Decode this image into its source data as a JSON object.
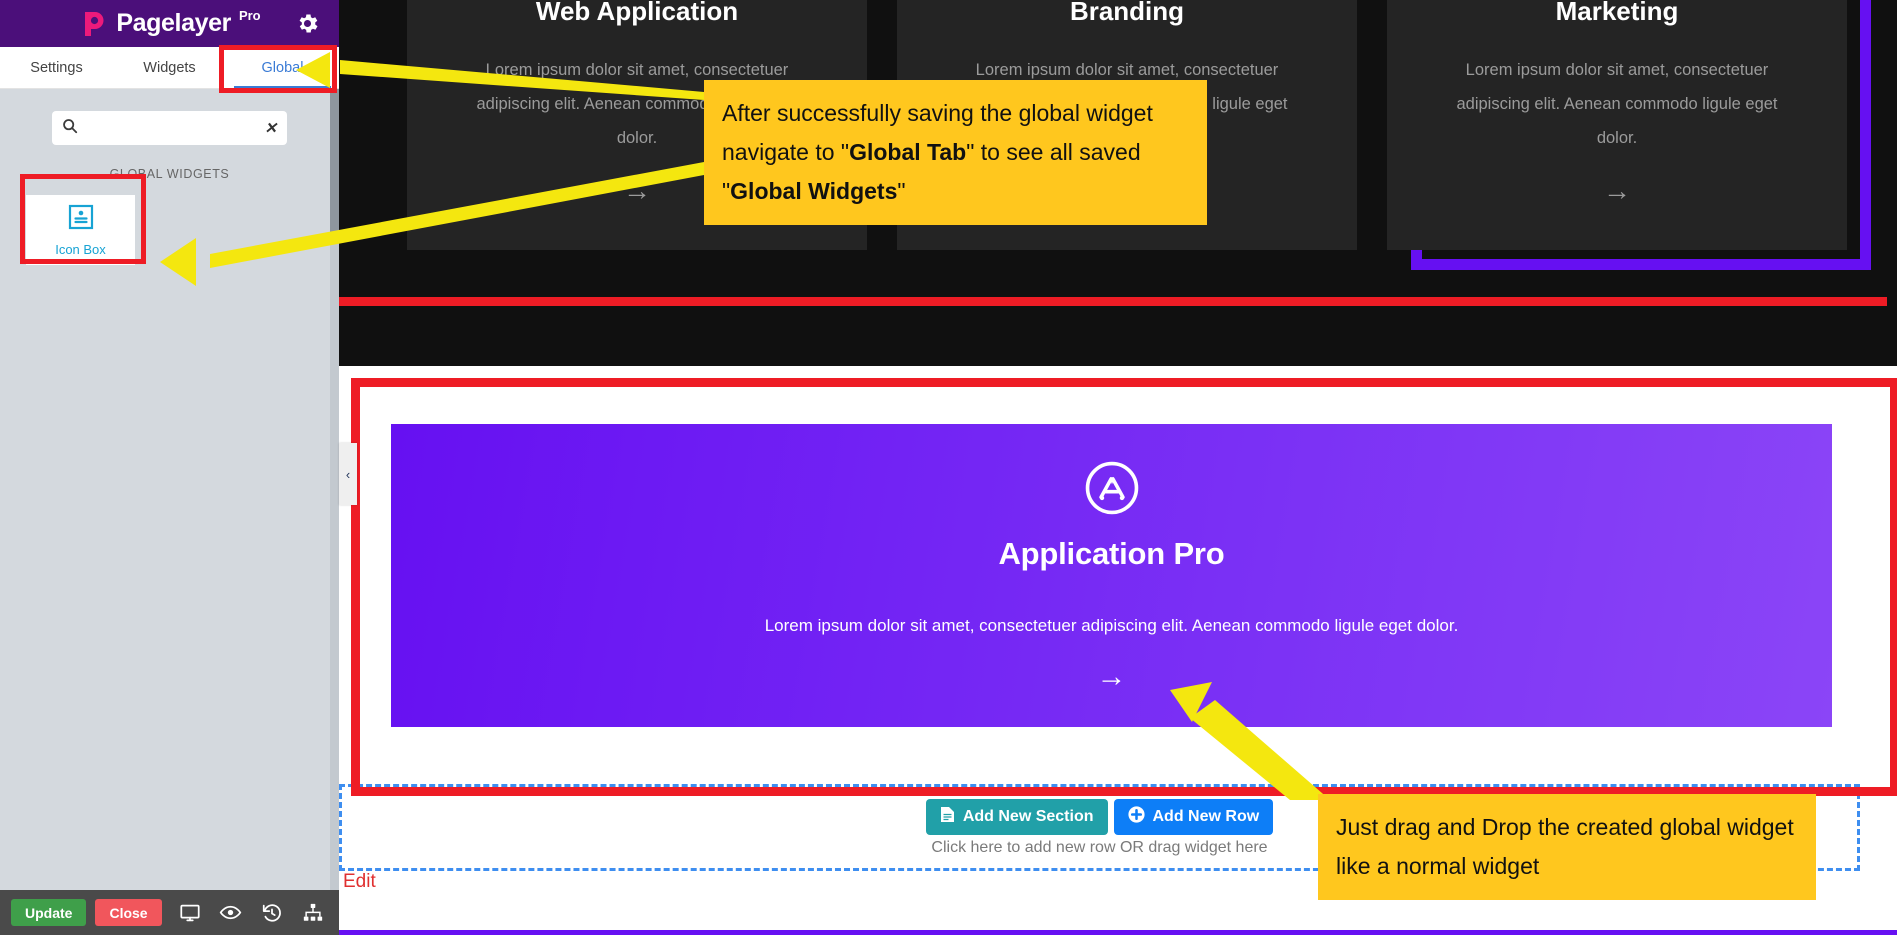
{
  "app": {
    "brand_name": "Pagelayer",
    "brand_suffix": "Pro",
    "logo_icon": "pagelayer-p-logo",
    "settings_icon": "gear-icon"
  },
  "sidebar": {
    "tabs": [
      {
        "label": "Settings",
        "active": false
      },
      {
        "label": "Widgets",
        "active": false
      },
      {
        "label": "Global",
        "active": true
      }
    ],
    "search": {
      "value": "",
      "placeholder": "",
      "icon": "search-icon",
      "clear_icon": "clear-x-icon"
    },
    "section_label": "GLOBAL WIDGETS",
    "widgets": [
      {
        "label": "Icon Box",
        "icon": "icon-box-icon"
      }
    ],
    "footer": {
      "update_label": "Update",
      "close_label": "Close",
      "icons": [
        "desktop-icon",
        "eye-icon",
        "history-revert-icon",
        "sitemap-icon"
      ]
    },
    "collapse_icon": "chevron-left-icon"
  },
  "canvas": {
    "service_cards": [
      {
        "title": "Web Application",
        "description": "Lorem ipsum dolor sit amet, consectetuer adipiscing elit. Aenean commodo ligule eget dolor.",
        "arrow": "→"
      },
      {
        "title": "Branding",
        "description": "Lorem ipsum dolor sit amet, consectetuer adipiscing elit. Aenean commodo ligule eget dolor.",
        "arrow": "→"
      },
      {
        "title": "Marketing",
        "description": "Lorem ipsum dolor sit amet, consectetuer adipiscing elit. Aenean commodo ligule eget dolor.",
        "arrow": "→"
      }
    ],
    "global_widget": {
      "icon": "app-store-icon",
      "title": "Application Pro",
      "description": "Lorem ipsum dolor sit amet, consectetuer adipiscing elit. Aenean commodo ligule eget dolor.",
      "arrow": "→"
    },
    "add_row_zone": {
      "add_section_label": "Add New Section",
      "add_section_icon": "file-icon",
      "add_row_label": "Add New Row",
      "add_row_icon": "plus-circle-icon",
      "hint": "Click here to add new row OR drag widget here"
    },
    "edit_label": "Edit"
  },
  "annotations": {
    "callout_1": {
      "part1": "After successfully saving the global widget navigate to \"",
      "bold1": "Global Tab",
      "part2": "\" to see all saved \"",
      "bold2": "Global Widgets",
      "part3": "\""
    },
    "callout_2": {
      "text": "Just drag and Drop the created global widget like a normal widget"
    }
  },
  "colors": {
    "brand_purple": "#4b0f7a",
    "brand_pink": "#ec1a7b",
    "accent_blue": "#3a7bd5",
    "highlight_red": "#ee1c25",
    "callout_yellow": "#ffc71e",
    "widget_purple": "#6610f2",
    "update_green": "#3f9f4a",
    "close_red": "#f1565c",
    "teal": "#21a0a8",
    "blue": "#0d7ef7"
  }
}
